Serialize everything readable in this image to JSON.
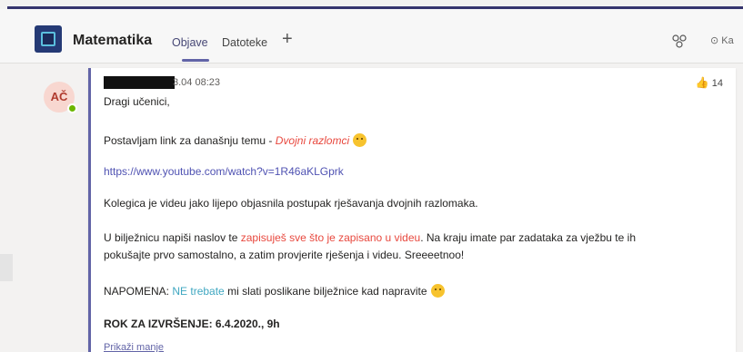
{
  "header": {
    "team_name": "Matematika",
    "tabs": [
      {
        "label": "Objave"
      },
      {
        "label": "Datoteke"
      }
    ],
    "add_tab_symbol": "+",
    "right_button": "⊙ Ka"
  },
  "post": {
    "avatar_initials": "AČ",
    "timestamp": "3.04 08:23",
    "like_count": "14",
    "greeting": "Dragi učenici,",
    "line2_prefix": "Postavljam link za današnju temu - ",
    "line2_topic": "Dvojni razlomci",
    "url": "https://www.youtube.com/watch?v=1R46aKLGprk",
    "line4": "Kolegica je videu jako lijepo objasnila postupak rješavanja dvojnih razlomaka.",
    "line5_prefix": "U bilježnicu napiši naslov te ",
    "line5_red": "zapisuješ sve što je zapisano u videu",
    "line5_suffix": ". Na kraju imate par zadataka za vježbu te ih",
    "line6": "pokušajte prvo samostalno, a zatim provjerite rješenja i videu. Sreeeetnoo!",
    "line7_prefix": "NAPOMENA: ",
    "line7_teal": "NE trebate",
    "line7_suffix": " mi slati poslikane bilježnice kad napravite",
    "deadline": "ROK ZA IZVRŠENJE: 6.4.2020., 9h",
    "show_less": "Prikaži manje"
  },
  "colors": {
    "accent": "#6264a7",
    "red_text": "#e8483e",
    "teal_text": "#3fa7c1",
    "presence": "#6bb700"
  }
}
